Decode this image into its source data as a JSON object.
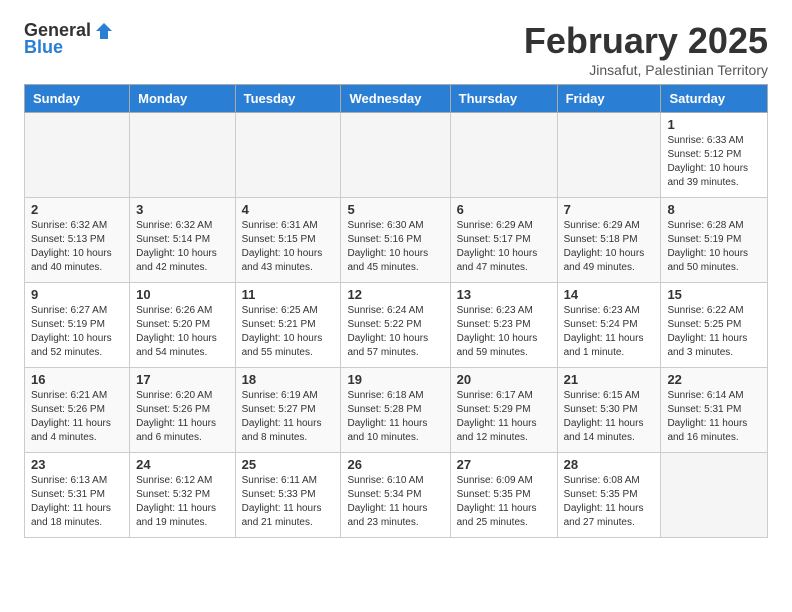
{
  "header": {
    "logo_general": "General",
    "logo_blue": "Blue",
    "title": "February 2025",
    "subtitle": "Jinsafut, Palestinian Territory"
  },
  "weekdays": [
    "Sunday",
    "Monday",
    "Tuesday",
    "Wednesday",
    "Thursday",
    "Friday",
    "Saturday"
  ],
  "weeks": [
    [
      {
        "num": "",
        "info": ""
      },
      {
        "num": "",
        "info": ""
      },
      {
        "num": "",
        "info": ""
      },
      {
        "num": "",
        "info": ""
      },
      {
        "num": "",
        "info": ""
      },
      {
        "num": "",
        "info": ""
      },
      {
        "num": "1",
        "info": "Sunrise: 6:33 AM\nSunset: 5:12 PM\nDaylight: 10 hours and 39 minutes."
      }
    ],
    [
      {
        "num": "2",
        "info": "Sunrise: 6:32 AM\nSunset: 5:13 PM\nDaylight: 10 hours and 40 minutes."
      },
      {
        "num": "3",
        "info": "Sunrise: 6:32 AM\nSunset: 5:14 PM\nDaylight: 10 hours and 42 minutes."
      },
      {
        "num": "4",
        "info": "Sunrise: 6:31 AM\nSunset: 5:15 PM\nDaylight: 10 hours and 43 minutes."
      },
      {
        "num": "5",
        "info": "Sunrise: 6:30 AM\nSunset: 5:16 PM\nDaylight: 10 hours and 45 minutes."
      },
      {
        "num": "6",
        "info": "Sunrise: 6:29 AM\nSunset: 5:17 PM\nDaylight: 10 hours and 47 minutes."
      },
      {
        "num": "7",
        "info": "Sunrise: 6:29 AM\nSunset: 5:18 PM\nDaylight: 10 hours and 49 minutes."
      },
      {
        "num": "8",
        "info": "Sunrise: 6:28 AM\nSunset: 5:19 PM\nDaylight: 10 hours and 50 minutes."
      }
    ],
    [
      {
        "num": "9",
        "info": "Sunrise: 6:27 AM\nSunset: 5:19 PM\nDaylight: 10 hours and 52 minutes."
      },
      {
        "num": "10",
        "info": "Sunrise: 6:26 AM\nSunset: 5:20 PM\nDaylight: 10 hours and 54 minutes."
      },
      {
        "num": "11",
        "info": "Sunrise: 6:25 AM\nSunset: 5:21 PM\nDaylight: 10 hours and 55 minutes."
      },
      {
        "num": "12",
        "info": "Sunrise: 6:24 AM\nSunset: 5:22 PM\nDaylight: 10 hours and 57 minutes."
      },
      {
        "num": "13",
        "info": "Sunrise: 6:23 AM\nSunset: 5:23 PM\nDaylight: 10 hours and 59 minutes."
      },
      {
        "num": "14",
        "info": "Sunrise: 6:23 AM\nSunset: 5:24 PM\nDaylight: 11 hours and 1 minute."
      },
      {
        "num": "15",
        "info": "Sunrise: 6:22 AM\nSunset: 5:25 PM\nDaylight: 11 hours and 3 minutes."
      }
    ],
    [
      {
        "num": "16",
        "info": "Sunrise: 6:21 AM\nSunset: 5:26 PM\nDaylight: 11 hours and 4 minutes."
      },
      {
        "num": "17",
        "info": "Sunrise: 6:20 AM\nSunset: 5:26 PM\nDaylight: 11 hours and 6 minutes."
      },
      {
        "num": "18",
        "info": "Sunrise: 6:19 AM\nSunset: 5:27 PM\nDaylight: 11 hours and 8 minutes."
      },
      {
        "num": "19",
        "info": "Sunrise: 6:18 AM\nSunset: 5:28 PM\nDaylight: 11 hours and 10 minutes."
      },
      {
        "num": "20",
        "info": "Sunrise: 6:17 AM\nSunset: 5:29 PM\nDaylight: 11 hours and 12 minutes."
      },
      {
        "num": "21",
        "info": "Sunrise: 6:15 AM\nSunset: 5:30 PM\nDaylight: 11 hours and 14 minutes."
      },
      {
        "num": "22",
        "info": "Sunrise: 6:14 AM\nSunset: 5:31 PM\nDaylight: 11 hours and 16 minutes."
      }
    ],
    [
      {
        "num": "23",
        "info": "Sunrise: 6:13 AM\nSunset: 5:31 PM\nDaylight: 11 hours and 18 minutes."
      },
      {
        "num": "24",
        "info": "Sunrise: 6:12 AM\nSunset: 5:32 PM\nDaylight: 11 hours and 19 minutes."
      },
      {
        "num": "25",
        "info": "Sunrise: 6:11 AM\nSunset: 5:33 PM\nDaylight: 11 hours and 21 minutes."
      },
      {
        "num": "26",
        "info": "Sunrise: 6:10 AM\nSunset: 5:34 PM\nDaylight: 11 hours and 23 minutes."
      },
      {
        "num": "27",
        "info": "Sunrise: 6:09 AM\nSunset: 5:35 PM\nDaylight: 11 hours and 25 minutes."
      },
      {
        "num": "28",
        "info": "Sunrise: 6:08 AM\nSunset: 5:35 PM\nDaylight: 11 hours and 27 minutes."
      },
      {
        "num": "",
        "info": ""
      }
    ]
  ]
}
